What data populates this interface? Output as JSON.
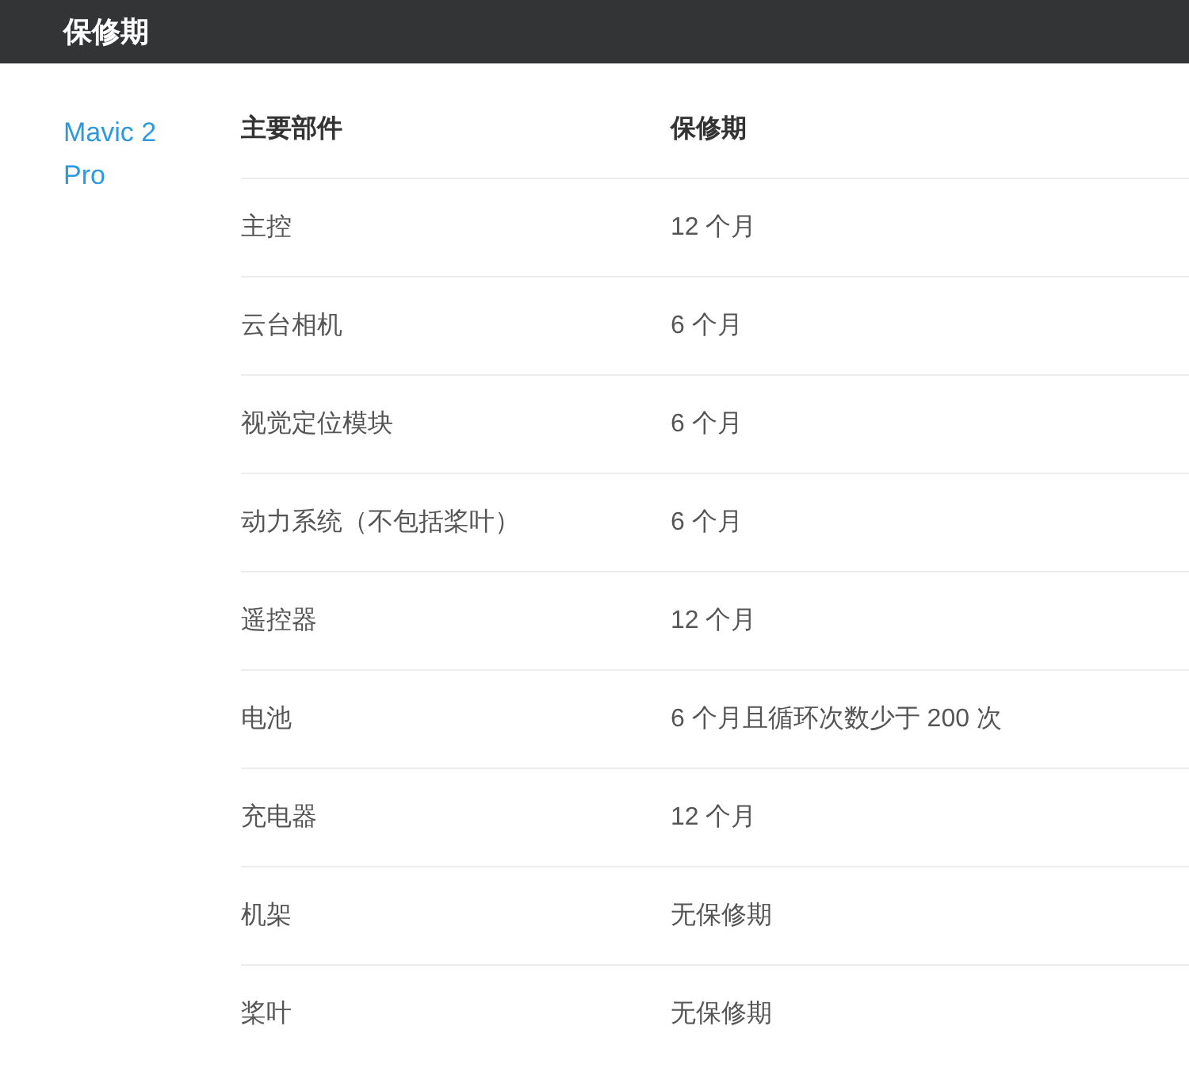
{
  "header": {
    "title": "保修期"
  },
  "model": "Mavic 2 Pro",
  "table": {
    "columns": [
      "主要部件",
      "保修期"
    ],
    "rows": [
      [
        "主控",
        "12 个月"
      ],
      [
        "云台相机",
        "6 个月"
      ],
      [
        "视觉定位模块",
        "6 个月"
      ],
      [
        "动力系统（不包括桨叶）",
        "6 个月"
      ],
      [
        "遥控器",
        "12 个月"
      ],
      [
        "电池",
        "6 个月且循环次数少于 200 次"
      ],
      [
        "充电器",
        "12 个月"
      ],
      [
        "机架",
        "无保修期"
      ],
      [
        "桨叶",
        "无保修期"
      ]
    ]
  }
}
